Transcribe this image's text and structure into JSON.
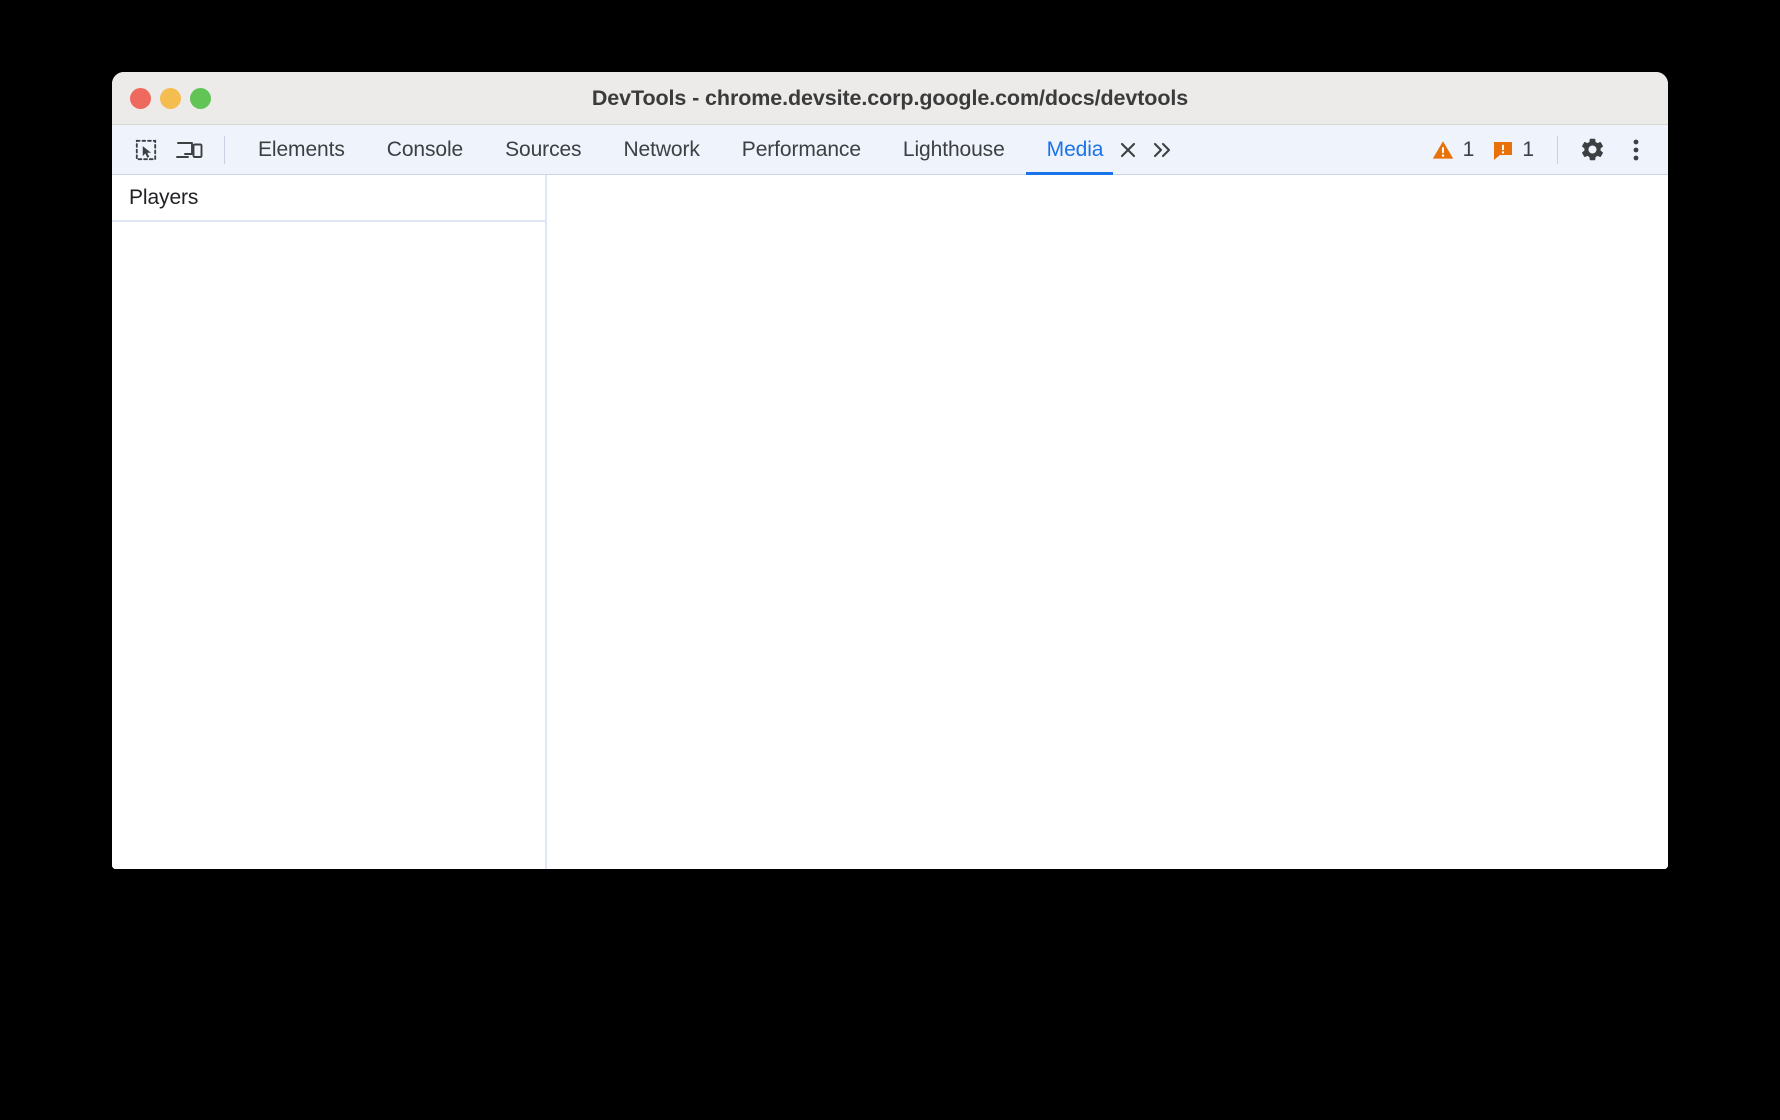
{
  "window": {
    "title": "DevTools - chrome.devsite.corp.google.com/docs/devtools",
    "controls": {
      "close_label": "close",
      "minimize_label": "minimize",
      "zoom_label": "zoom"
    }
  },
  "toolbar": {
    "inspect_icon": "inspect-element-icon",
    "device_icon": "device-toolbar-icon",
    "tabs": [
      {
        "label": "Elements",
        "active": false
      },
      {
        "label": "Console",
        "active": false
      },
      {
        "label": "Sources",
        "active": false
      },
      {
        "label": "Network",
        "active": false
      },
      {
        "label": "Performance",
        "active": false
      },
      {
        "label": "Lighthouse",
        "active": false
      },
      {
        "label": "Media",
        "active": true
      }
    ],
    "close_tab_icon": "close-icon",
    "more_tabs_icon": "chevron-double-right-icon",
    "warning_count": "1",
    "issue_count": "1",
    "warning_icon": "warning-triangle-icon",
    "issue_icon": "issue-message-icon",
    "settings_icon": "gear-icon",
    "more_options_icon": "kebab-menu-icon"
  },
  "media_panel": {
    "players_header": "Players",
    "players": []
  },
  "colors": {
    "accent": "#1a73e8",
    "warning": "#e37400",
    "issue": "#e8710a",
    "toolbar_bg": "#eff3fb",
    "titlebar_bg": "#ecebe9",
    "text": "#3c4043"
  }
}
